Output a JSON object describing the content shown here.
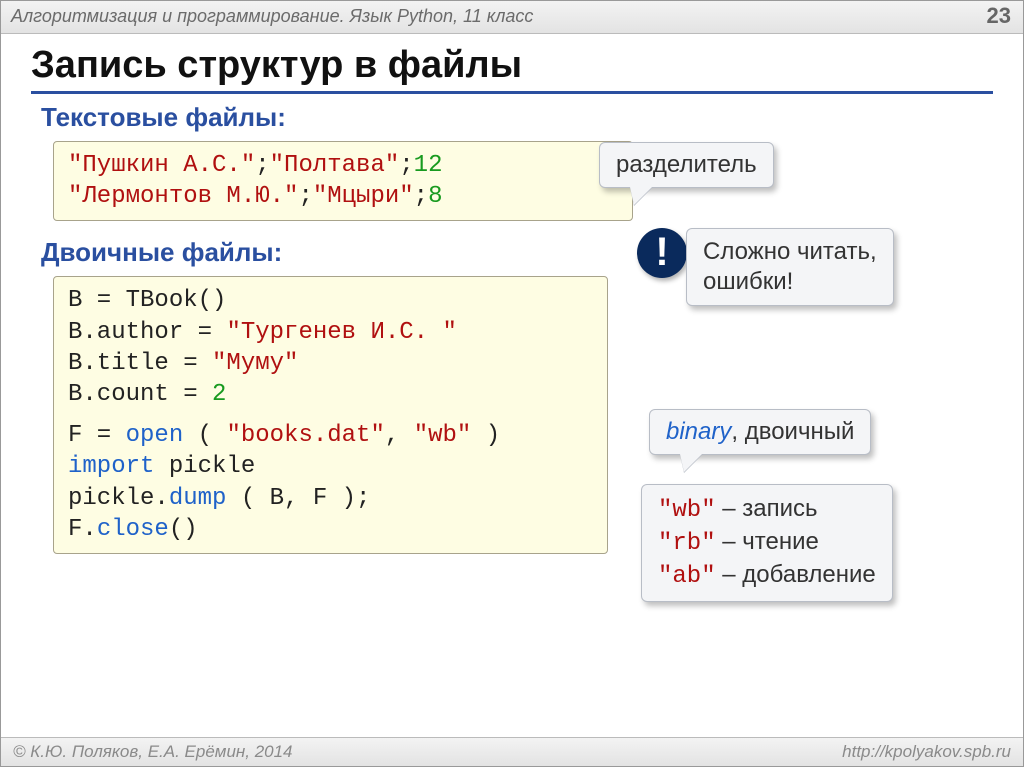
{
  "header": {
    "title": "Алгоритмизация и программирование. Язык Python, 11 класс",
    "page": "23"
  },
  "h1": "Запись структур в файлы",
  "section_text": "Текстовые файлы:",
  "section_bin": "Двоичные файлы:",
  "box1": {
    "l1a": "\"Пушкин А.С.\"",
    "l1b": ";",
    "l1c": "\"Полтава\"",
    "l1d": ";",
    "l1e": "12",
    "l2a": "\"Лермонтов М.Ю.\"",
    "l2b": ";",
    "l2c": "\"Мцыри\"",
    "l2d": ";",
    "l2e": "8"
  },
  "box2": {
    "l1": "B = TBook()",
    "l2a": "B.author = ",
    "l2b": "\"Тургенев И.С. \"",
    "l3a": "B.title = ",
    "l3b": "\"Муму\"",
    "l4a": "B.count = ",
    "l4b": "2",
    "l5a": "F = ",
    "l5b": "open",
    "l5c": " ( ",
    "l5d": "\"books.dat\"",
    "l5e": ", ",
    "l5f": "\"wb\"",
    "l5g": " )",
    "l6a": "import",
    "l6b": " pickle",
    "l7a": "pickle.",
    "l7b": "dump",
    "l7c": " ( B, F );",
    "l8a": "F.",
    "l8b": "close",
    "l8c": "()"
  },
  "callouts": {
    "delim": "разделитель",
    "warn_l1": "Сложно читать,",
    "warn_l2": "ошибки!",
    "bin_italic": "binary",
    "bin_rest": ", двоичный",
    "modes": {
      "wb": "\"wb\"",
      "wb_t": " – запись",
      "rb": "\"rb\"",
      "rb_t": " – чтение",
      "ab": "\"ab\"",
      "ab_t": " – добавление"
    }
  },
  "alert": "!",
  "footer": {
    "left": "© К.Ю. Поляков, Е.А. Ерёмин, 2014",
    "right": "http://kpolyakov.spb.ru"
  }
}
